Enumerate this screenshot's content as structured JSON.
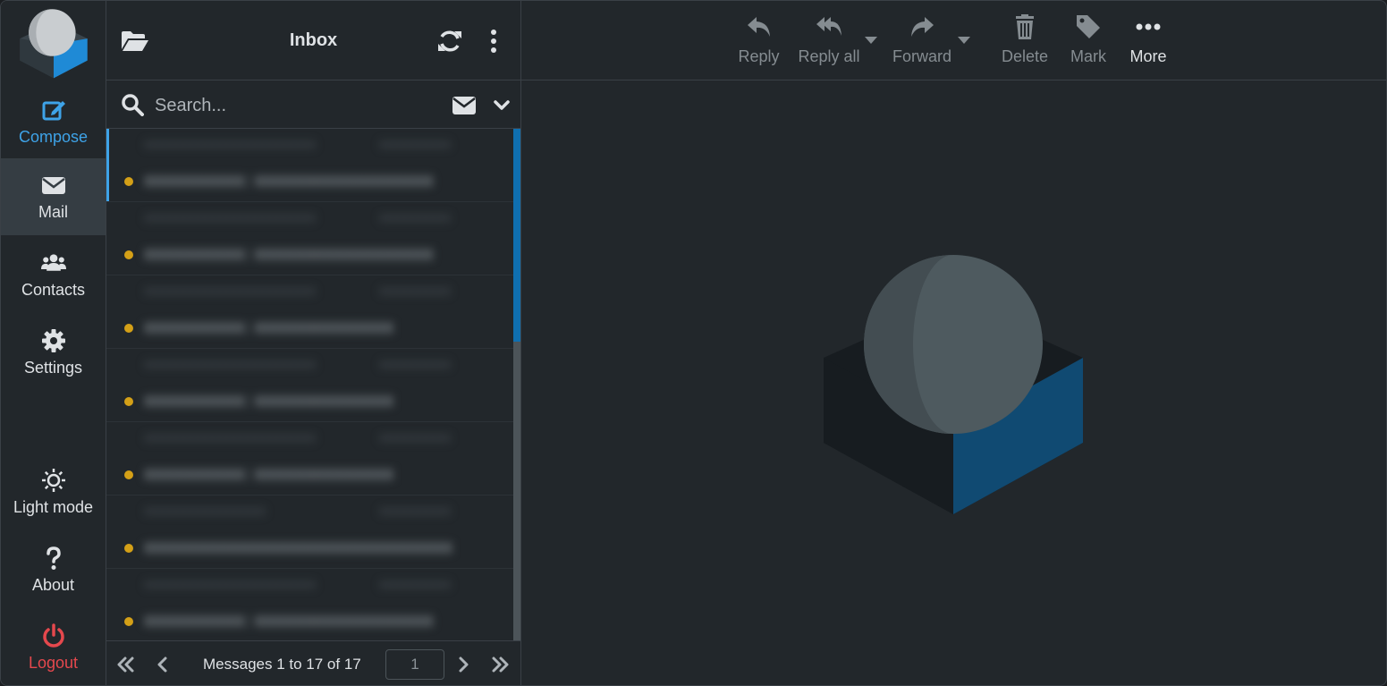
{
  "nav": {
    "compose": "Compose",
    "mail": "Mail",
    "contacts": "Contacts",
    "settings": "Settings",
    "light_mode": "Light mode",
    "about": "About",
    "logout": "Logout"
  },
  "list": {
    "folder_title": "Inbox",
    "search_placeholder": "Search...",
    "pager_info": "Messages 1 to 17 of 17",
    "page_value": "1"
  },
  "toolbar": {
    "reply": "Reply",
    "reply_all": "Reply all",
    "forward": "Forward",
    "delete": "Delete",
    "mark": "Mark",
    "more": "More"
  },
  "colors": {
    "accent": "#3ea3e8",
    "unread_dot": "#d4a017",
    "logout": "#e5484d",
    "background": "#22272b"
  },
  "icons": {
    "compose": "edit-icon",
    "mail": "envelope-icon",
    "contacts": "users-icon",
    "settings": "gear-icon",
    "light_mode": "sun-icon",
    "about": "question-icon",
    "logout": "power-icon"
  }
}
